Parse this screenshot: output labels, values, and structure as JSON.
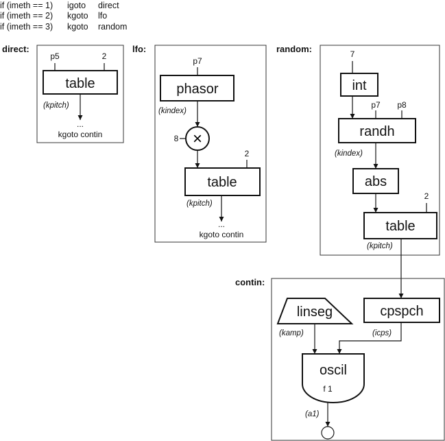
{
  "header": {
    "lines": [
      {
        "cond": "if (imeth == 1)",
        "op": "igoto",
        "target": "direct"
      },
      {
        "cond": "if (imeth == 2)",
        "op": "kgoto",
        "target": "lfo"
      },
      {
        "cond": "if (imeth == 3)",
        "op": "kgoto",
        "target": "random"
      }
    ]
  },
  "direct": {
    "label": "direct:",
    "in1": "p5",
    "in2": "2",
    "module": "table",
    "out": "(kpitch)",
    "ellipsis": "...",
    "goto": "kgoto contin"
  },
  "lfo": {
    "label": "lfo:",
    "in1": "p7",
    "phasor": "phasor",
    "phasor_out": "(kindex)",
    "mult_in": "8",
    "mult_symbol": "×",
    "table_in": "2",
    "module": "table",
    "out": "(kpitch)",
    "ellipsis": "...",
    "goto": "kgoto contin"
  },
  "random": {
    "label": "random:",
    "int_in": "7",
    "int": "int",
    "randh_in1": "p7",
    "randh_in2": "p8",
    "randh": "randh",
    "randh_out": "(kindex)",
    "abs": "abs",
    "table_in": "2",
    "module": "table",
    "out": "(kpitch)"
  },
  "contin": {
    "label": "contin:",
    "linseg": "linseg",
    "linseg_out": "(kamp)",
    "cpspch": "cpspch",
    "cpspch_out": "(icps)",
    "oscil": "oscil",
    "oscil_table": "f 1",
    "oscil_out": "(a1)"
  }
}
